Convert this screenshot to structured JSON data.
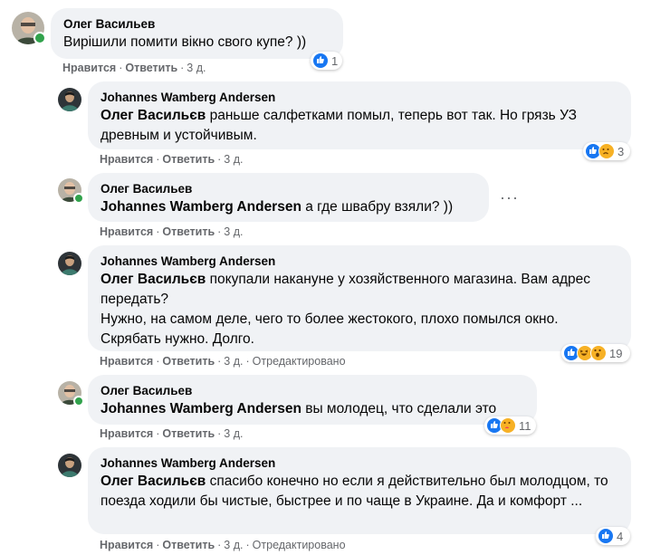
{
  "comments": [
    {
      "author": "Олег Васильев",
      "mention": "",
      "text": "Вирішили помити вікно свого купе? ))",
      "actions": {
        "like": "Нравится",
        "reply": "Ответить",
        "time": "3 д.",
        "edited": ""
      },
      "reactions": {
        "icons": [
          "like-icon"
        ],
        "count": "1"
      },
      "avatar": "avatar-oleg",
      "online": true
    },
    {
      "author": "Johannes Wamberg Andersen",
      "mention": "Олег Васильєв",
      "text": " раньше салфеткaми помыл, теперь вот так. Но грязь УЗ древным и устойчивым.",
      "actions": {
        "like": "Нравится",
        "reply": "Ответить",
        "time": "3 д.",
        "edited": ""
      },
      "reactions": {
        "icons": [
          "like-icon",
          "sad-icon"
        ],
        "count": "3"
      },
      "avatar": "avatar-johannes",
      "online": false
    },
    {
      "author": "Олег Васильев",
      "mention": "Johannes Wamberg Andersen",
      "text": " а где швабру взяли? ))",
      "actions": {
        "like": "Нравится",
        "reply": "Ответить",
        "time": "3 д.",
        "edited": ""
      },
      "reactions": {
        "icons": [],
        "count": ""
      },
      "avatar": "avatar-oleg",
      "online": true,
      "more_label": "···"
    },
    {
      "author": "Johannes Wamberg Andersen",
      "mention": "Олег Васильєв",
      "text": " покупали накануне у хозяйственного магазина. Вам адрес передать?\nНужно, на самом деле, чего то более жестокого, плохо помылся окно. Скрябать нужно. Долго.",
      "actions": {
        "like": "Нравится",
        "reply": "Ответить",
        "time": "3 д.",
        "edited": "Отредактировано"
      },
      "reactions": {
        "icons": [
          "like-icon",
          "haha-icon",
          "wow-icon"
        ],
        "count": "19"
      },
      "avatar": "avatar-johannes",
      "online": false
    },
    {
      "author": "Олег Васильев",
      "mention": "Johannes Wamberg Andersen",
      "text": " вы молодец, что сделали это",
      "actions": {
        "like": "Нравится",
        "reply": "Ответить",
        "time": "3 д.",
        "edited": ""
      },
      "reactions": {
        "icons": [
          "like-icon",
          "care-icon"
        ],
        "count": "11"
      },
      "avatar": "avatar-oleg",
      "online": true
    },
    {
      "author": "Johannes Wamberg Andersen",
      "mention": "Олег Васильєв",
      "text": " спасибо конечно но если я действительно был молодцом, то поезда ходили бы чистые, быстрее и по чаще в Украине. Да и комфорт ...",
      "actions": {
        "like": "Нравится",
        "reply": "Ответить",
        "time": "3 д.",
        "edited": "Отредактировано"
      },
      "reactions": {
        "icons": [
          "like-icon"
        ],
        "count": "4"
      },
      "avatar": "avatar-johannes",
      "online": false
    }
  ],
  "colors": {
    "bubble": "#f0f2f5",
    "meta": "#65676b",
    "like": "#1877f2",
    "online": "#31a24c"
  }
}
